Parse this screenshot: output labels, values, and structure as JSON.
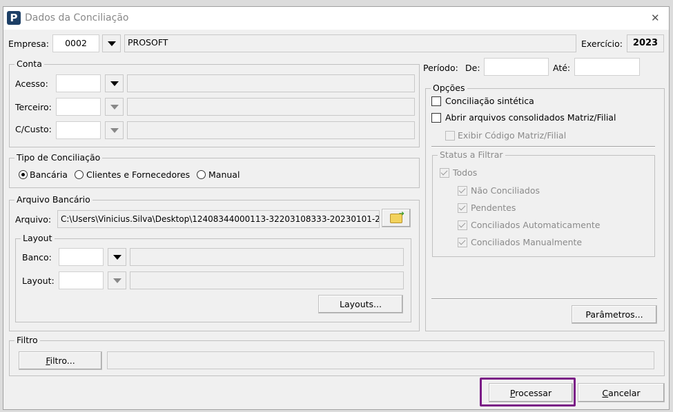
{
  "window": {
    "title": "Dados da Conciliação",
    "close": "✕"
  },
  "empresa": {
    "label": "Empresa:",
    "code": "0002",
    "name": "PROSOFT"
  },
  "exercicio": {
    "label": "Exercício:",
    "value": "2023"
  },
  "conta": {
    "title": "Conta",
    "rows": [
      {
        "label": "Acesso:",
        "value": "",
        "desc": ""
      },
      {
        "label": "Terceiro:",
        "value": "",
        "desc": ""
      },
      {
        "label": "C/Custo:",
        "value": "",
        "desc": ""
      }
    ]
  },
  "tipo": {
    "title": "Tipo de Conciliação",
    "options": [
      "Bancária",
      "Clientes e Fornecedores",
      "Manual"
    ],
    "selected": "Bancária"
  },
  "arquivo": {
    "title": "Arquivo Bancário",
    "label": "Arquivo:",
    "value": "C:\\Users\\Vinicius.Silva\\Desktop\\12408344000113-32203108333-20230101-2"
  },
  "layout": {
    "title": "Layout",
    "banco_label": "Banco:",
    "layout_label": "Layout:",
    "button": "Layouts..."
  },
  "periodo": {
    "label": "Período:",
    "de_label": "De:",
    "de": "",
    "ate_label": "Até:",
    "ate": ""
  },
  "opcoes": {
    "title": "Opções",
    "sintetica": "Conciliação sintética",
    "abrir": "Abrir arquivos consolidados Matriz/Filial",
    "exibir": "Exibir Código Matriz/Filial",
    "parametros": "Parâmetros..."
  },
  "status": {
    "title": "Status a Filtrar",
    "todos": "Todos",
    "items": [
      "Não Conciliados",
      "Pendentes",
      "Conciliados Automaticamente",
      "Conciliados Manualmente"
    ]
  },
  "filtro": {
    "title": "Filtro",
    "button": "Filtro...",
    "value": ""
  },
  "actions": {
    "processar": "Processar",
    "cancelar": "Cancelar",
    "highlight_color": "#7a1a86"
  }
}
